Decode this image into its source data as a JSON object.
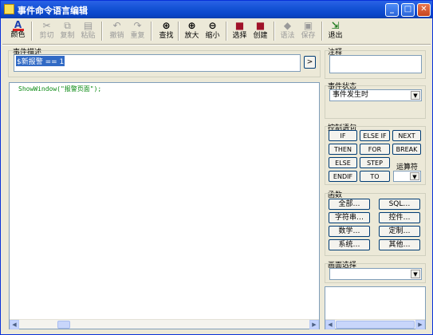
{
  "window": {
    "title": "事件命令语言编辑",
    "minimize_glyph": "_",
    "maximize_glyph": "□",
    "close_glyph": "✕"
  },
  "toolbar": {
    "items": [
      {
        "label": "颜色",
        "icon": "A",
        "enabled": true
      },
      {
        "label": "剪切",
        "icon": "✂",
        "enabled": false
      },
      {
        "label": "复制",
        "icon": "⧉",
        "enabled": false
      },
      {
        "label": "粘贴",
        "icon": "▤",
        "enabled": false
      },
      {
        "label": "撤销",
        "icon": "↶",
        "enabled": false
      },
      {
        "label": "重复",
        "icon": "↷",
        "enabled": false
      },
      {
        "label": "查找",
        "icon": "⊛",
        "enabled": true
      },
      {
        "label": "放大",
        "icon": "⊕",
        "enabled": true
      },
      {
        "label": "缩小",
        "icon": "⊖",
        "enabled": true
      },
      {
        "label": "选择",
        "icon": "■",
        "enabled": true
      },
      {
        "label": "创建",
        "icon": "■",
        "enabled": true
      },
      {
        "label": "语法",
        "icon": "◆",
        "enabled": false
      },
      {
        "label": "保存",
        "icon": "▣",
        "enabled": false
      },
      {
        "label": "退出",
        "icon": "⇲",
        "enabled": true
      }
    ]
  },
  "event_description": {
    "label": "事件描述",
    "value": "$新报警 == 1",
    "button_label": ">"
  },
  "editor": {
    "code": "ShowWindow(\"报警页面\");"
  },
  "comment": {
    "label": "注释",
    "value": ""
  },
  "event_state": {
    "label": "事件状态",
    "selected": "事件发生时"
  },
  "control_statements": {
    "label": "控制语句",
    "buttons": [
      "IF",
      "ELSE IF",
      "NEXT",
      "THEN",
      "FOR",
      "BREAK",
      "ELSE",
      "STEP",
      "ENDIF",
      "TO"
    ],
    "operator_label": "运算符",
    "operator_selected": ""
  },
  "functions": {
    "label": "函数",
    "buttons": [
      "全部…",
      "SQL…",
      "字符串…",
      "控件…",
      "数学…",
      "定制…",
      "系统…",
      "其他…"
    ]
  },
  "screen_select": {
    "label": "画面选择",
    "selected": ""
  },
  "colors": {
    "title_bar": "#0a46c9",
    "selection": "#316ac5",
    "code_text": "#0a8a12"
  }
}
